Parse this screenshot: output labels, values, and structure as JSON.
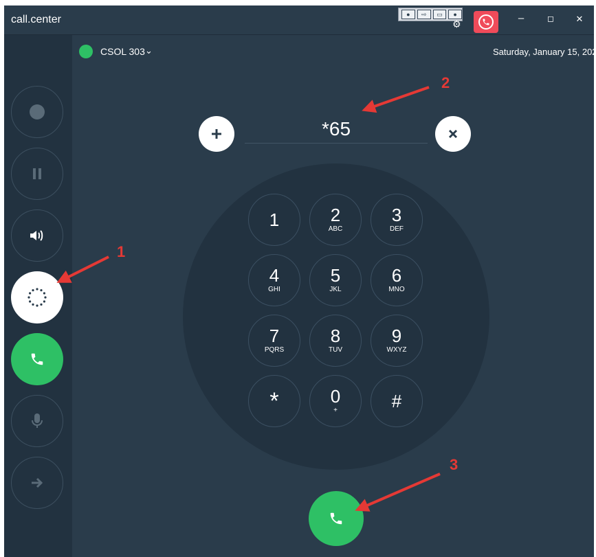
{
  "titlebar": {
    "title": "call.center",
    "minimize": "‒",
    "maximize": "◻",
    "close": "✕"
  },
  "header": {
    "agent": "CSOL 303",
    "date": "Saturday, January 15, 202"
  },
  "dialer": {
    "value": "*65",
    "keys": [
      {
        "digit": "1",
        "letters": ""
      },
      {
        "digit": "2",
        "letters": "ABC"
      },
      {
        "digit": "3",
        "letters": "DEF"
      },
      {
        "digit": "4",
        "letters": "GHI"
      },
      {
        "digit": "5",
        "letters": "JKL"
      },
      {
        "digit": "6",
        "letters": "MNO"
      },
      {
        "digit": "7",
        "letters": "PQRS"
      },
      {
        "digit": "8",
        "letters": "TUV"
      },
      {
        "digit": "9",
        "letters": "WXYZ"
      },
      {
        "digit": "*",
        "letters": ""
      },
      {
        "digit": "0",
        "letters": "+"
      },
      {
        "digit": "#",
        "letters": ""
      }
    ]
  },
  "annotations": [
    "1",
    "2",
    "3"
  ],
  "colors": {
    "background": "#2a3c4b",
    "sidebar": "#223240",
    "green": "#2ec065",
    "alert": "#f04b5a",
    "annotation": "#e53935"
  }
}
